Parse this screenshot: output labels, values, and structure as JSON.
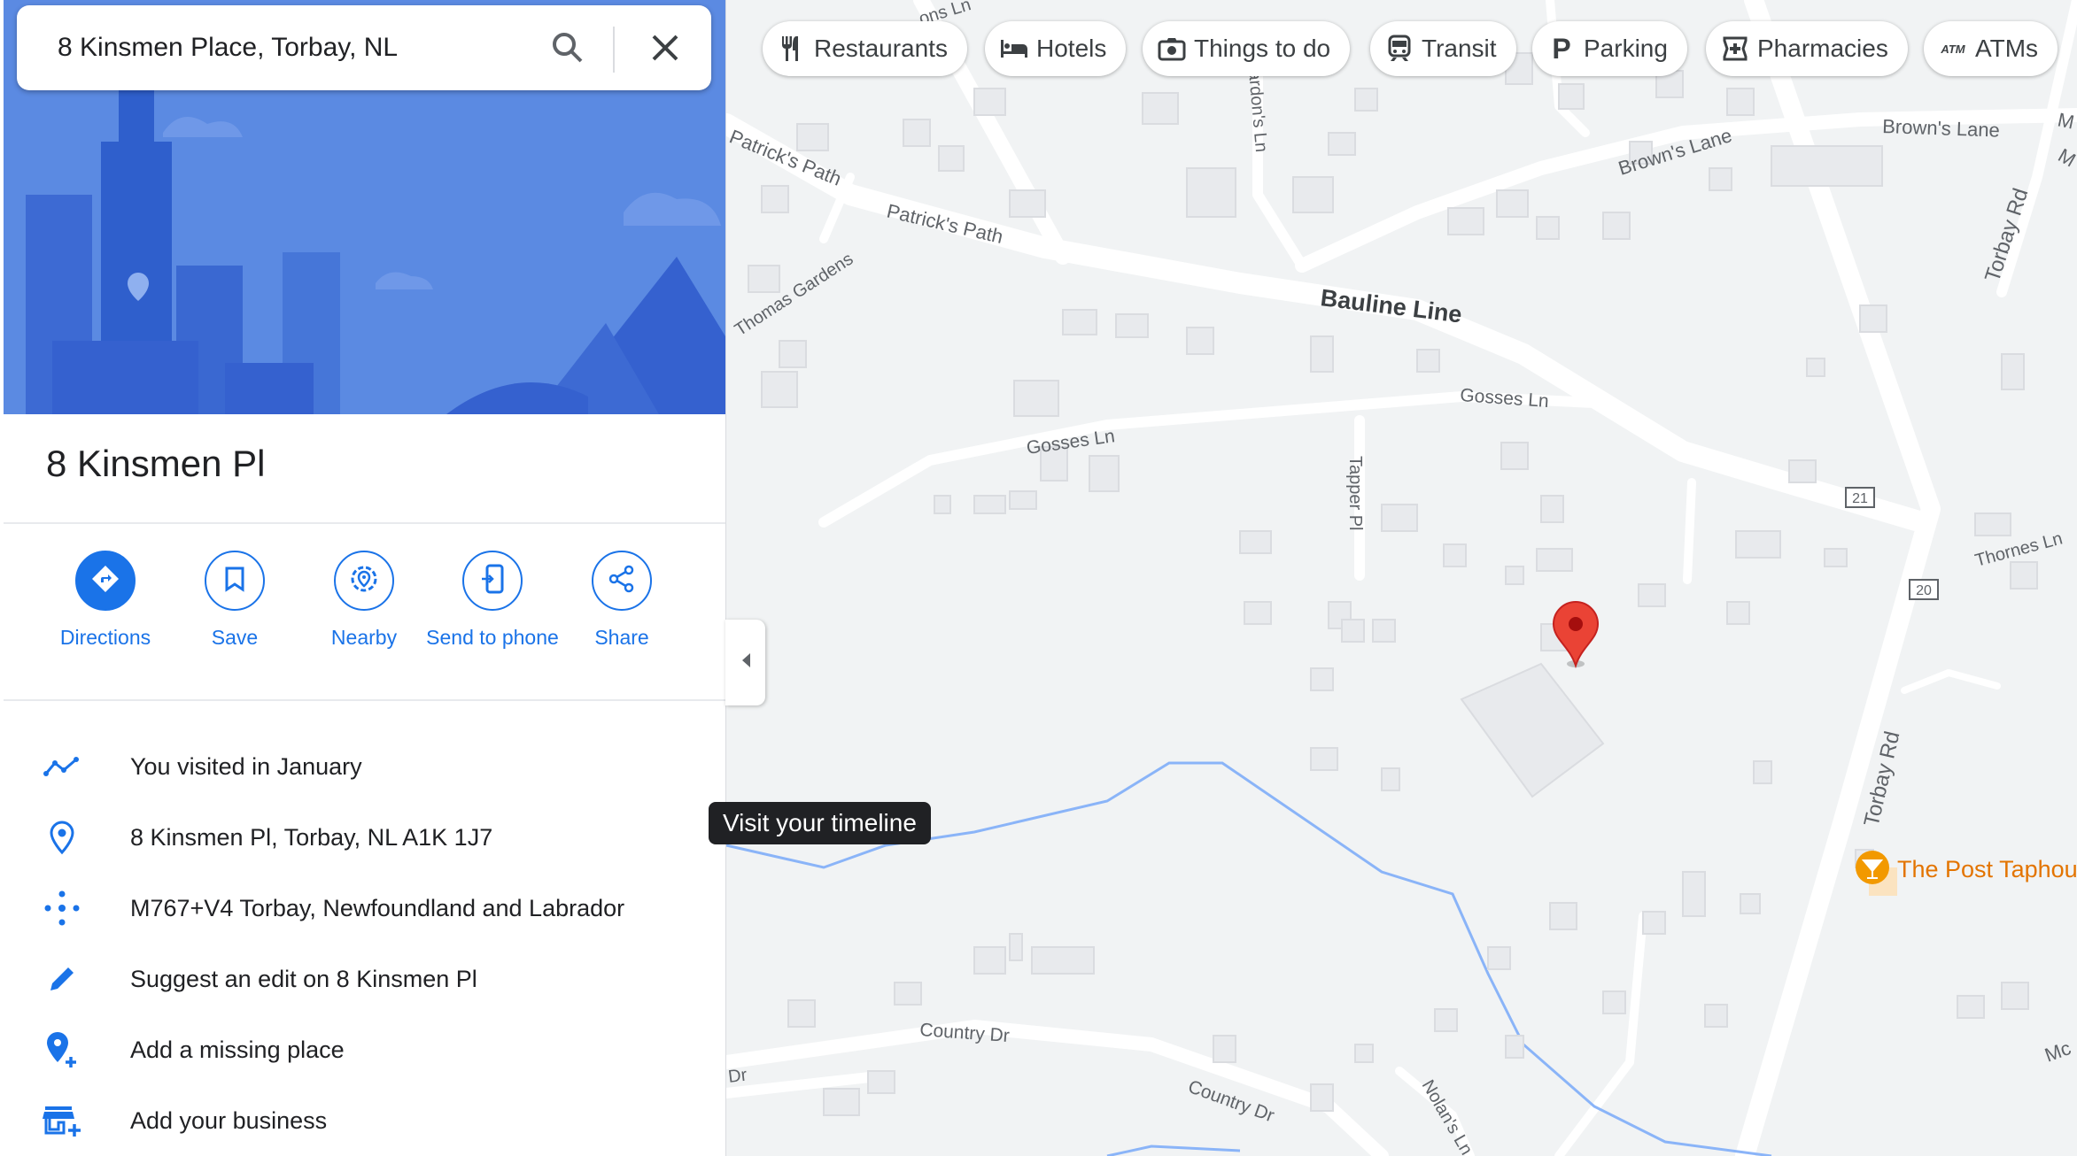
{
  "search": {
    "value": "8 Kinsmen Place, Torbay, NL"
  },
  "place": {
    "title": "8 Kinsmen Pl"
  },
  "actions": [
    {
      "label": "Directions"
    },
    {
      "label": "Save"
    },
    {
      "label": "Nearby"
    },
    {
      "label": "Send to phone"
    },
    {
      "label": "Share"
    }
  ],
  "info": {
    "timeline": "You visited in January",
    "address": "8 Kinsmen Pl, Torbay, NL A1K 1J7",
    "plus_code": "M767+V4 Torbay, Newfoundland and Labrador",
    "suggest_edit": "Suggest an edit on 8 Kinsmen Pl",
    "add_place": "Add a missing place",
    "add_business": "Add your business"
  },
  "tooltip": "Visit your timeline",
  "chips": [
    {
      "label": "Restaurants",
      "icon": "fork-knife-icon"
    },
    {
      "label": "Hotels",
      "icon": "bed-icon"
    },
    {
      "label": "Things to do",
      "icon": "camera-icon"
    },
    {
      "label": "Transit",
      "icon": "train-icon"
    },
    {
      "label": "Parking",
      "icon": "parking-icon"
    },
    {
      "label": "Pharmacies",
      "icon": "pharmacy-icon"
    },
    {
      "label": "ATMs",
      "icon": "atm-icon"
    }
  ],
  "map_labels": {
    "bauline_line": "Bauline Line",
    "browns_lane_1": "Brown's Lane",
    "browns_lane_2": "Brown's Lane",
    "patricks_path_1": "Patrick's Path",
    "patricks_path_2": "Patrick's Path",
    "thomas_gardens": "Thomas Gardens",
    "gosses_ln_1": "Gosses Ln",
    "gosses_ln_2": "Gosses Ln",
    "tapper_pl": "Tapper Pl",
    "torbay_rd_1": "Torbay Rd",
    "torbay_rd_2": "Torbay Rd",
    "thornes_ln": "Thornes Ln",
    "country_dr_1": "Country Dr",
    "country_dr_2": "Country Dr",
    "nolans_ln": "Nolan's Ln",
    "jordans_ln": "ardon's Ln",
    "top_label": "ons Ln",
    "route_21": "21",
    "route_20": "20",
    "poi_name": "The Post Taphou",
    "edge_dr": "Dr",
    "edge_m1": "M",
    "edge_m2": "M",
    "edge_mc": "Mc"
  },
  "colors": {
    "accent": "#1a73e8",
    "marker": "#ea4335",
    "poi": "#f29900",
    "water": "#8ab4f8"
  }
}
